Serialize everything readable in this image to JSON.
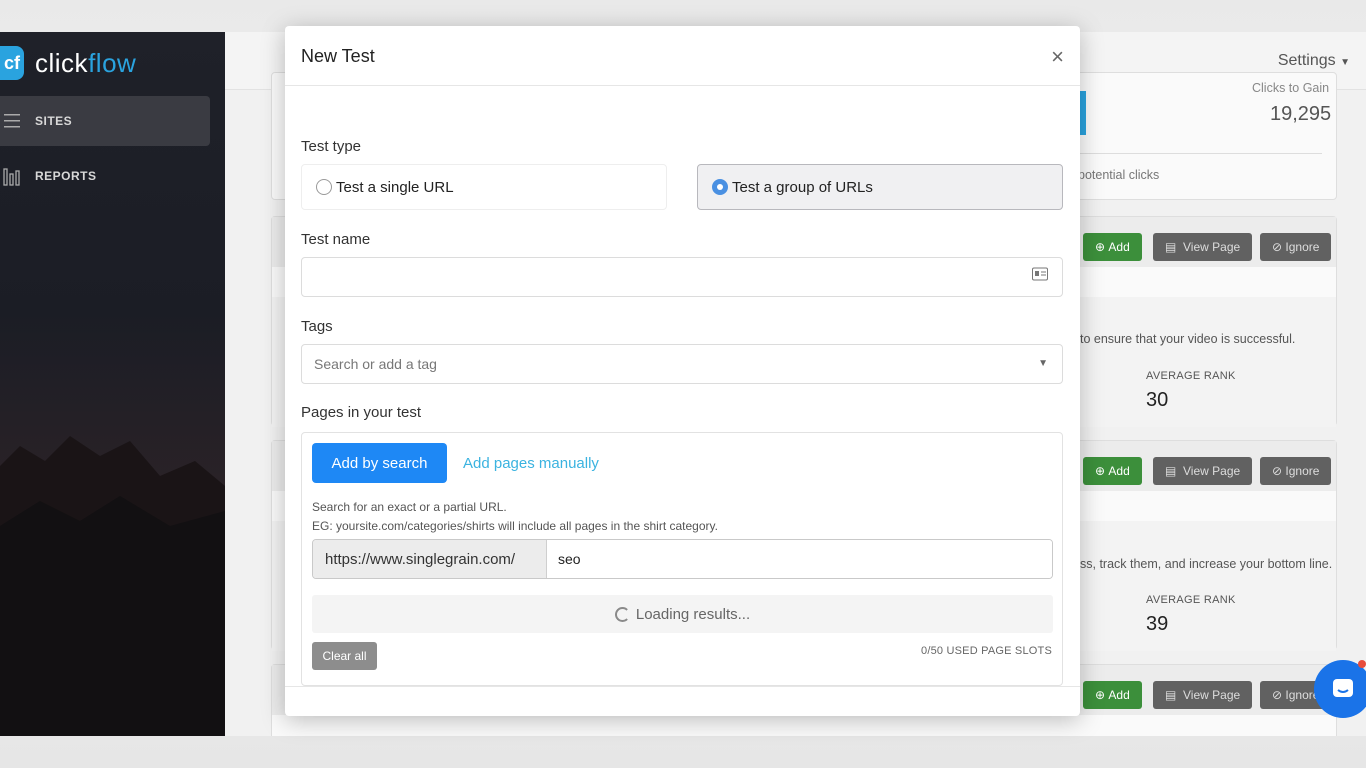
{
  "app": {
    "logo_prefix": "click",
    "logo_suffix": "flow",
    "logo_mark": "cf"
  },
  "sidebar": {
    "items": [
      {
        "label": "SITES",
        "icon": "menu-icon",
        "active": true
      },
      {
        "label": "REPORTS",
        "icon": "bar-chart-icon",
        "active": false
      }
    ]
  },
  "topbar": {
    "settings_label": "Settings"
  },
  "background": {
    "clicks_heading": "Clicks to Gain",
    "clicks_value": "19,295",
    "potential_text": "potential clicks",
    "card_actions": {
      "add": "Add",
      "view": "View Page",
      "ignore": "Ignore"
    },
    "rows": [
      {
        "text": "to ensure that your video is successful.",
        "rank_label": "AVERAGE RANK",
        "rank": "30"
      },
      {
        "text": "ss, track them, and increase your bottom line.",
        "rank_label": "AVERAGE RANK",
        "rank": "39"
      }
    ]
  },
  "modal": {
    "title": "New Test",
    "close_label": "×",
    "test_type": {
      "label": "Test type",
      "options": [
        "Test a single URL",
        "Test a group of URLs"
      ],
      "selected_index": 1
    },
    "test_name": {
      "label": "Test name",
      "value": "",
      "placeholder": ""
    },
    "tags": {
      "label": "Tags",
      "placeholder": "Search or add a tag"
    },
    "pages": {
      "label": "Pages in your test",
      "add_by_search": "Add by search",
      "add_manually": "Add pages manually",
      "help_line1": "Search for an exact or a partial URL.",
      "help_line2": "EG: yoursite.com/categories/shirts will include all pages in the shirt category.",
      "url_prefix": "https://www.singlegrain.com/",
      "search_value": "seo",
      "loading_text": "Loading results...",
      "clear_all": "Clear all",
      "slots_text": "0/50 USED PAGE SLOTS"
    }
  },
  "colors": {
    "primary": "#1e88f5",
    "link": "#3bb3e0",
    "brand": "#2aa3df",
    "green": "#3c8f3b"
  }
}
